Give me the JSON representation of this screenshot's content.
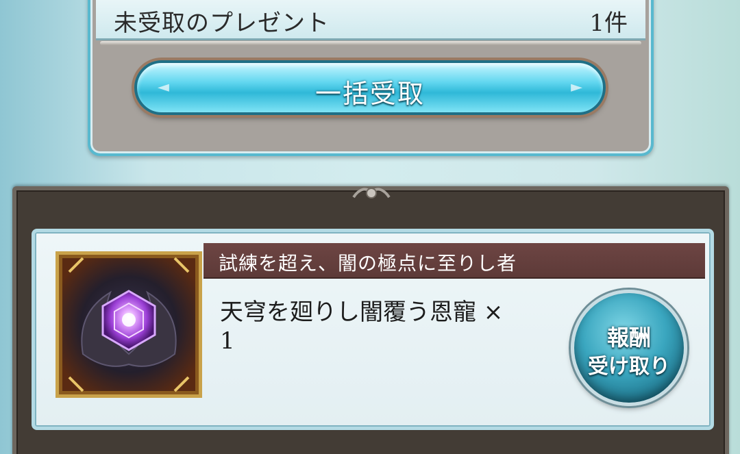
{
  "summary": {
    "label": "未受取のプレゼント",
    "count": "1件",
    "receive_all_label": "一括受取"
  },
  "mission": {
    "title": "試練を超え、闇の極点に至りし者",
    "reward_name": "天穹を廻りし闇覆う恩寵 ×",
    "reward_quantity": "1",
    "reward_icon": "dark-gem-icon",
    "claim_line1": "報酬",
    "claim_line2": "受け取り"
  },
  "colors": {
    "accent_cyan": "#4fd0ea",
    "title_bar": "#6d4543",
    "frame_dark": "#433c35"
  }
}
